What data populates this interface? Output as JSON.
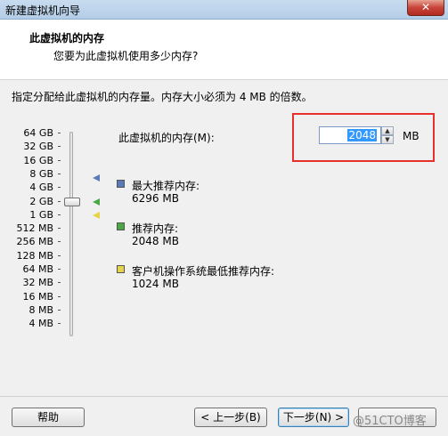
{
  "window": {
    "title": "新建虚拟机向导",
    "close_label": "✕"
  },
  "header": {
    "title": "此虚拟机的内存",
    "subtitle": "您要为此虚拟机使用多少内存?"
  },
  "instruction": "指定分配给此虚拟机的内存量。内存大小必须为 4 MB 的倍数。",
  "scale_labels": [
    "64 GB",
    "32 GB",
    "16 GB",
    "8 GB",
    "4 GB",
    "2 GB",
    "1 GB",
    "512 MB",
    "256 MB",
    "128 MB",
    "64 MB",
    "32 MB",
    "16 MB",
    "8 MB",
    "4 MB"
  ],
  "memory": {
    "label": "此虚拟机的内存(M):",
    "value": "2048",
    "unit": "MB"
  },
  "legend": {
    "max": {
      "title": "最大推荐内存:",
      "value": "6296 MB",
      "color": "#5a7ab8"
    },
    "recommended": {
      "title": "推荐内存:",
      "value": "2048 MB",
      "color": "#4aa845"
    },
    "minimum": {
      "title": "客户机操作系统最低推荐内存:",
      "value": "1024 MB",
      "color": "#e3d44a"
    }
  },
  "buttons": {
    "help": "帮助",
    "back": "< 上一步(B)",
    "next": "下一步(N) >",
    "finish": ""
  },
  "watermark": "@51CTO博客",
  "colors": {
    "highlight": "#e8302a",
    "selection": "#3399ff"
  }
}
